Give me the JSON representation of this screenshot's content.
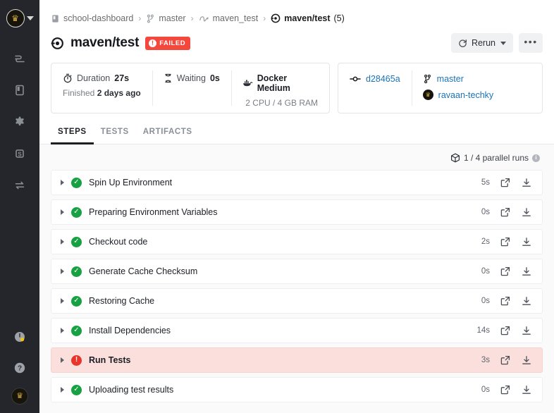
{
  "sidebar": {
    "account_avatar": "crown-avatar",
    "nav_items": [
      {
        "name": "pipelines-icon",
        "icon": "pipeline"
      },
      {
        "name": "docs-icon",
        "icon": "book"
      },
      {
        "name": "settings-icon",
        "icon": "gear"
      },
      {
        "name": "billing-icon",
        "icon": "dollar"
      },
      {
        "name": "integrations-icon",
        "icon": "swap"
      }
    ],
    "bottom_items": [
      {
        "name": "status-icon",
        "icon": "gauge"
      },
      {
        "name": "help-icon",
        "icon": "question"
      },
      {
        "name": "user-avatar",
        "icon": "crown-avatar"
      }
    ]
  },
  "breadcrumb": [
    {
      "label": "school-dashboard",
      "icon": "project-icon"
    },
    {
      "label": "master",
      "icon": "branch-icon"
    },
    {
      "label": "maven_test",
      "icon": "workflow-icon"
    },
    {
      "label": "maven/test",
      "sub": " (5)",
      "icon": "job-icon"
    }
  ],
  "breadcrumb_separator": "›",
  "header": {
    "title": "maven/test",
    "status_badge": "FAILED",
    "status_color": "#f4483c",
    "rerun_label": "Rerun",
    "more_label": "•••"
  },
  "info": {
    "duration_label": "Duration",
    "duration_value": "27s",
    "finished_label": "Finished",
    "finished_value": "2 days ago",
    "waiting_label": "Waiting",
    "waiting_value": "0s",
    "machine_label": "Docker Medium",
    "machine_specs": "2 CPU / 4 GB RAM",
    "commit_sha": "d28465a",
    "branch": "master",
    "author": "ravaan-techky"
  },
  "tabs": [
    {
      "label": "STEPS",
      "active": true
    },
    {
      "label": "TESTS",
      "active": false
    },
    {
      "label": "ARTIFACTS",
      "active": false
    }
  ],
  "parallel_runs": {
    "text": "1 / 4 parallel runs",
    "info_glyph": "i"
  },
  "steps": [
    {
      "name": "Spin Up Environment",
      "status": "success",
      "duration": "5s"
    },
    {
      "name": "Preparing Environment Variables",
      "status": "success",
      "duration": "0s"
    },
    {
      "name": "Checkout code",
      "status": "success",
      "duration": "2s"
    },
    {
      "name": "Generate Cache Checksum",
      "status": "success",
      "duration": "0s"
    },
    {
      "name": "Restoring Cache",
      "status": "success",
      "duration": "0s"
    },
    {
      "name": "Install Dependencies",
      "status": "success",
      "duration": "14s"
    },
    {
      "name": "Run Tests",
      "status": "failed",
      "duration": "3s"
    },
    {
      "name": "Uploading test results",
      "status": "success",
      "duration": "0s"
    }
  ],
  "colors": {
    "success": "#17a142",
    "failure": "#e8342a",
    "link": "#1a73b7",
    "failed_row_bg": "#fbdfdd",
    "sidebar_bg": "#24262b"
  }
}
